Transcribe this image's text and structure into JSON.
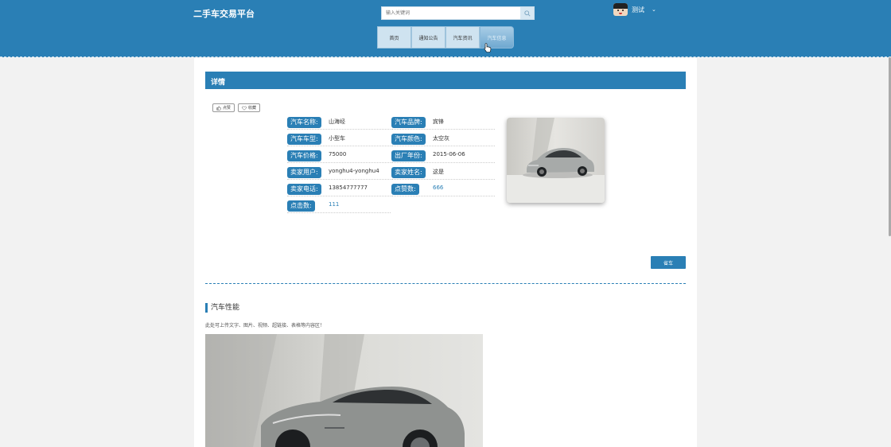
{
  "header": {
    "site_title": "二手车交易平台",
    "search_placeholder": "输入关键词",
    "user_name": "测试",
    "user_arrow": "⌄"
  },
  "nav": {
    "items": [
      {
        "label": "首页"
      },
      {
        "label": "通知公告"
      },
      {
        "label": "汽车资讯"
      },
      {
        "label": "汽车信息"
      }
    ],
    "active_index": 3
  },
  "detail": {
    "section_title": "详情",
    "like_label": "点赞",
    "favorite_label": "收藏",
    "fields": [
      {
        "label": "汽车名称:",
        "value": "山海经"
      },
      {
        "label": "汽车品牌:",
        "value": "宾锋"
      },
      {
        "label": "汽车车型:",
        "value": "小型车"
      },
      {
        "label": "汽车颜色:",
        "value": "太空灰"
      },
      {
        "label": "汽车价格:",
        "value": "75000"
      },
      {
        "label": "出厂年份:",
        "value": "2015-06-06"
      },
      {
        "label": "卖家用户:",
        "value": "yonghu4-yonghu4"
      },
      {
        "label": "卖家姓名:",
        "value": "这是"
      },
      {
        "label": "卖家电话:",
        "value": "13854777777"
      },
      {
        "label": "点赞数:",
        "value": "666"
      },
      {
        "label": "点击数:",
        "value": "111"
      }
    ],
    "buy_label": "省车"
  },
  "performance": {
    "title": "汽车性能",
    "description": "此处可上传文字、图片、视频、超链接、表格等内容区！"
  },
  "colors": {
    "primary": "#2a7fb5",
    "nav_bg": "#cfe3f0"
  }
}
